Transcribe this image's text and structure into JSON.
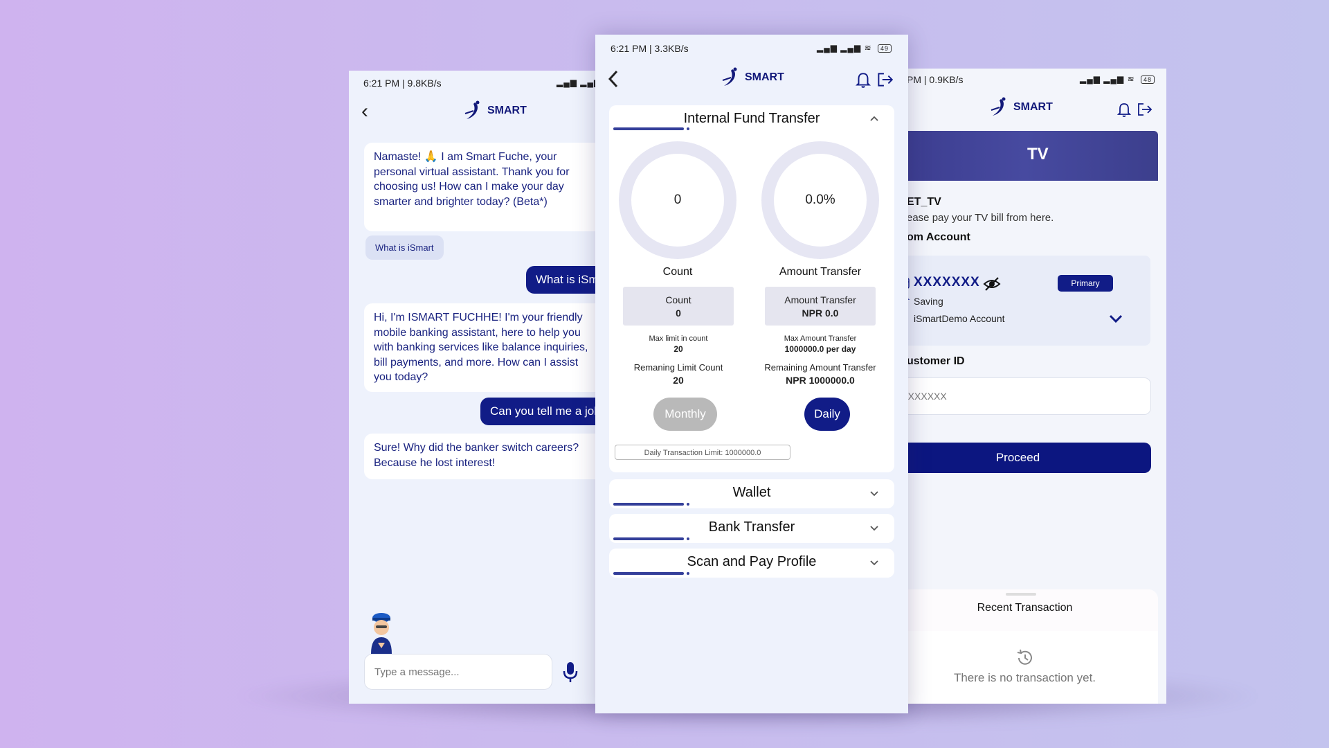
{
  "left": {
    "status_time": "6:21 PM | 9.8KB/s",
    "status_icons": "▂▄▆ ▂▄▆",
    "brand": "SMART",
    "messages": {
      "bot1": "Namaste! 🙏 I am Smart Fuche, your personal virtual assistant. Thank you for choosing us! How can I make your day smarter and brighter today? (Beta*)",
      "chip": "What is iSmart",
      "user1": "What is iSmart",
      "bot2": "Hi, I'm ISMART FUCHHE! I'm your friendly mobile banking assistant, here to help you with banking services like balance inquiries, bill payments, and more. How can I assist you today?",
      "user2": "Can you tell me a joke",
      "bot3": "Sure! Why did the banker switch careers? Because he lost interest!"
    },
    "input_placeholder": "Type a message..."
  },
  "center": {
    "status_time": "6:21 PM | 3.3KB/s",
    "status_icons": "▂▄▆ ▂▄▆ ≋",
    "battery": "49",
    "brand": "SMART",
    "section_main": "Internal Fund Transfer",
    "count_value": "0",
    "amount_value": "0.0%",
    "count_label": "Count",
    "amount_label": "Amount Transfer",
    "count_box_title": "Count",
    "count_box_value": "0",
    "amount_box_title": "Amount Transfer",
    "amount_box_value": "NPR 0.0",
    "max_count_label": "Max limit in count",
    "max_count_value": "20",
    "max_amount_label": "Max Amount Transfer",
    "max_amount_value": "1000000.0 per day",
    "remaining_count_label": "Remaning Limit Count",
    "remaining_count_value": "20",
    "remaining_amount_label": "Remaining Amount Transfer",
    "remaining_amount_value": "NPR 1000000.0",
    "monthly_label": "Monthly",
    "daily_label": "Daily",
    "daily_limit_text": "Daily Transaction Limit: 1000000.0",
    "sections": [
      "Wallet",
      "Bank Transfer",
      "Scan and Pay Profile"
    ],
    "colors": {
      "primary": "#111c87",
      "disabled": "#b9b9b9",
      "accent": "#343f9a"
    }
  },
  "right": {
    "status_time": "PM | 0.9KB/s",
    "status_icons": "▂▄▆ ▂▄▆ ≋",
    "battery": "48",
    "brand": "SMART",
    "banner_title": "TV",
    "service_name": "ET_TV",
    "service_desc": "ease pay your TV bill from here.",
    "from_account_label": "om Account",
    "account_number": "XXXXXXX",
    "account_badge": "Primary",
    "account_type": "Saving",
    "account_name": "iSmartDemo Account",
    "customer_id_label": "ustomer ID",
    "customer_id_placeholder": "XXXXXXXX",
    "proceed_label": "Proceed",
    "recent_title": "Recent Transaction",
    "empty_text": "There is no transaction yet."
  }
}
